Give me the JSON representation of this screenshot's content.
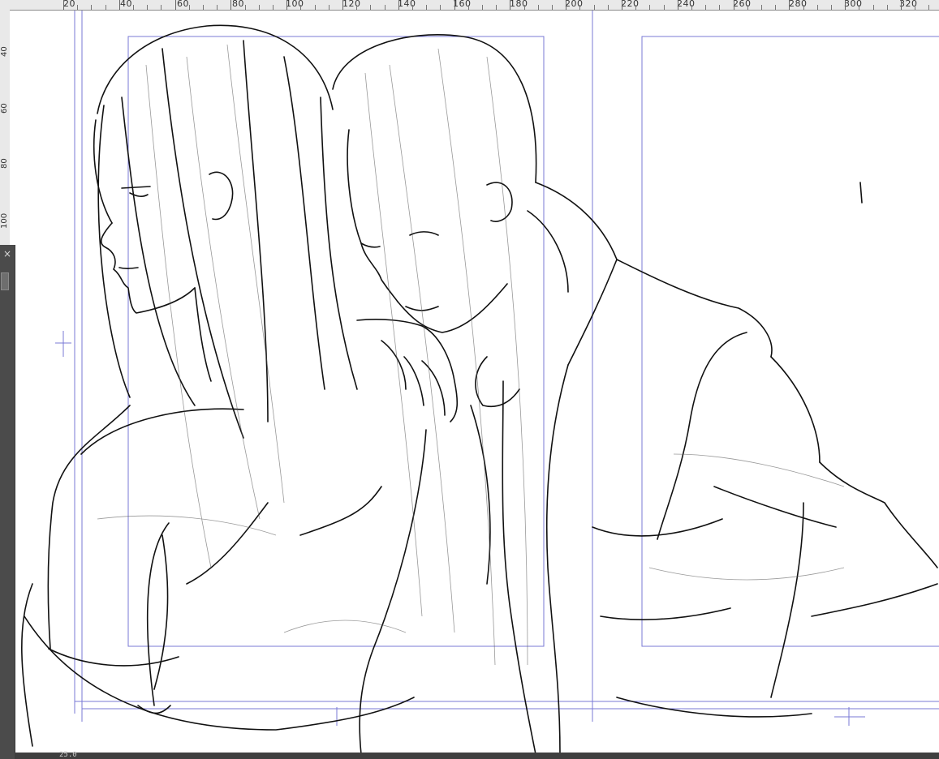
{
  "ruler": {
    "top_labels": [
      "20",
      "40",
      "60",
      "80",
      "100",
      "120",
      "140",
      "160",
      "180",
      "200",
      "220",
      "240",
      "260",
      "280",
      "300",
      "320"
    ],
    "left_labels": [
      "40",
      "60",
      "80",
      "100"
    ]
  },
  "side_panel": {
    "close_glyph": "×"
  },
  "status": {
    "zoom_text": "25.0"
  },
  "colors": {
    "guide": "#6a6ad0",
    "ink": "#111111",
    "ruler_bg": "#e9e9e9",
    "ui_dark": "#4a4a4a"
  }
}
